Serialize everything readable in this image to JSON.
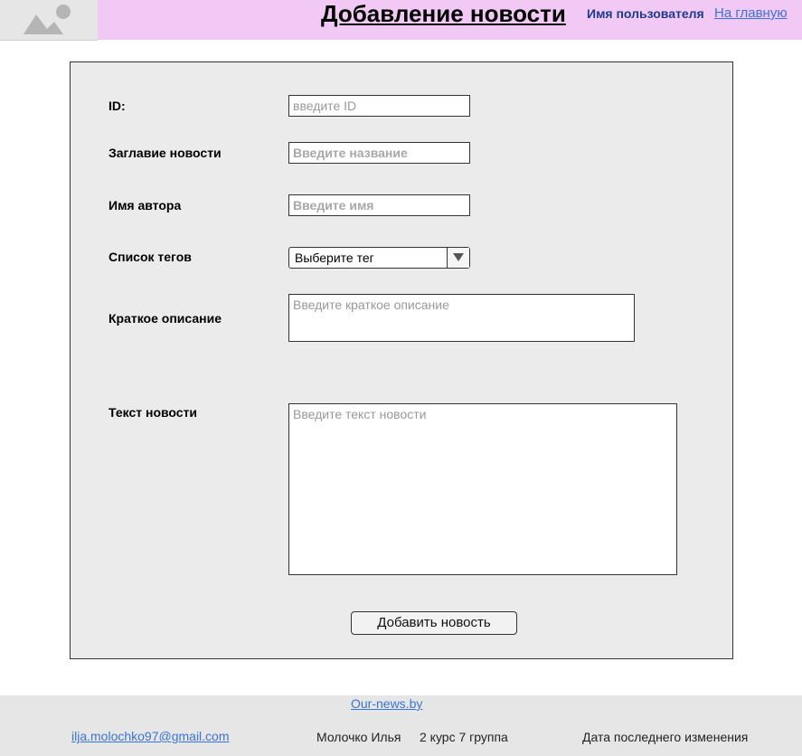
{
  "header": {
    "title": "Добавление новости",
    "user_name": "Имя пользователя",
    "home_link": "На главную"
  },
  "form": {
    "id": {
      "label": "ID:",
      "placeholder": "введите ID"
    },
    "title": {
      "label": "Заглавие новости",
      "placeholder": "Введите название"
    },
    "author": {
      "label": "Имя автора",
      "placeholder": "Введите имя"
    },
    "tags": {
      "label": "Список тегов",
      "selected": "Выберите тег"
    },
    "summary": {
      "label": "Краткое описание",
      "placeholder": "Введите краткое описание"
    },
    "body": {
      "label": "Текст новости",
      "placeholder": "Введите текст новости"
    },
    "submit_label": "Добавить новость"
  },
  "footer": {
    "site_link": "Our-news.by",
    "email": "ilja.molochko97@gmail.com",
    "author": "Молочко Илья",
    "group": "2 курс 7 группа",
    "last_modified": "Дата последнего изменения"
  },
  "colors": {
    "header_bg": "#f1c9f4",
    "panel_bg": "#ebebeb",
    "footer_bg": "#e6e6e6",
    "link": "#3a74d6"
  },
  "icons": {
    "logo": "image-placeholder-icon",
    "dropdown": "triangle-down-icon"
  }
}
